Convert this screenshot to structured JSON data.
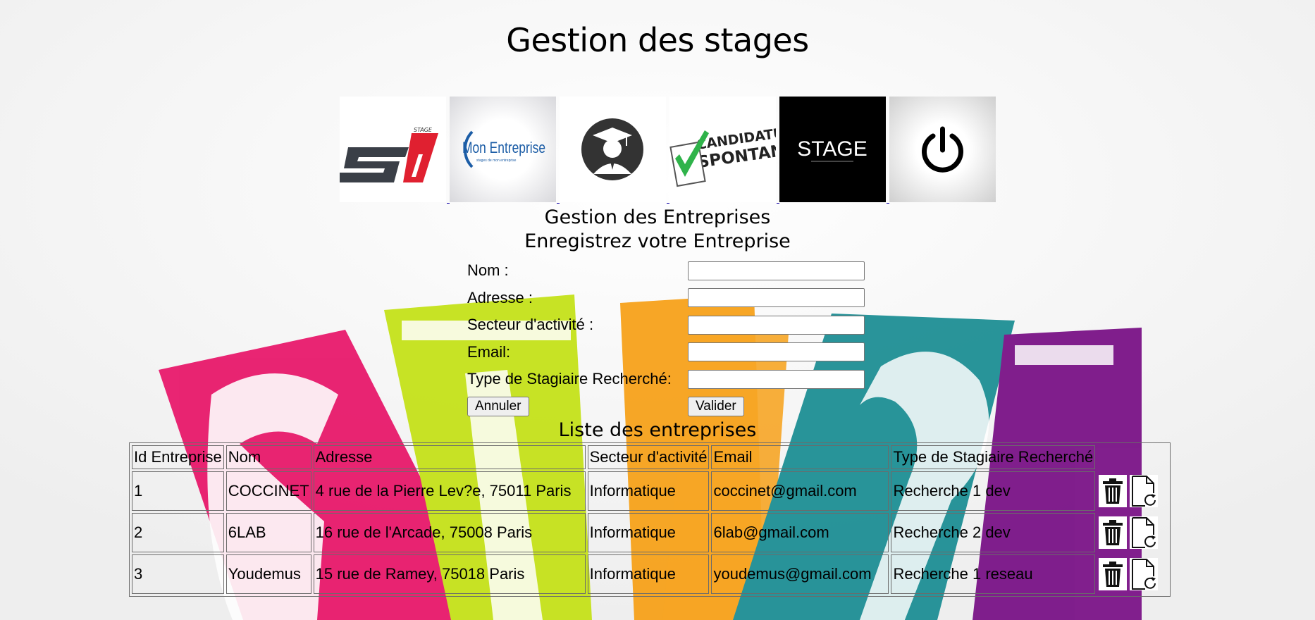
{
  "header": {
    "title": "Gestion des stages"
  },
  "nav": {
    "items": [
      {
        "icon": "stage-s1-logo",
        "logo_text": "STAGE",
        "logo_mark": "S1"
      },
      {
        "icon": "mon-entreprise-logo",
        "logo_text": "Mon Entreprise",
        "logo_sub": "stages de mon entreprise"
      },
      {
        "icon": "graduate-icon"
      },
      {
        "icon": "candidature-spontanee-logo",
        "logo_text_1": "CANDIDATURE",
        "logo_text_2": "SPONTANÉE"
      },
      {
        "icon": "stage-logo",
        "logo_text": "STAGE"
      },
      {
        "icon": "power-icon"
      }
    ]
  },
  "section": {
    "title": "Gestion des Entreprises",
    "subtitle": "Enregistrez votre Entreprise"
  },
  "form": {
    "nom_label": "Nom :",
    "adresse_label": "Adresse :",
    "secteur_label": "Secteur d'activité :",
    "email_label": "Email:",
    "type_label": "Type de Stagiaire Recherché:",
    "nom_value": "",
    "adresse_value": "",
    "secteur_value": "",
    "email_value": "",
    "type_value": "",
    "cancel_label": "Annuler",
    "submit_label": "Valider"
  },
  "list": {
    "title": "Liste des entreprises",
    "columns": [
      "Id Entreprise",
      "Nom",
      "Adresse",
      "Secteur d'activité",
      "Email",
      "Type de Stagiaire Recherché"
    ],
    "rows": [
      [
        "1",
        "COCCINET",
        "4 rue de la Pierre Lev?e, 75011 Paris",
        "Informatique",
        "coccinet@gmail.com",
        "Recherche 1 dev"
      ],
      [
        "2",
        "6LAB",
        "16 rue de l'Arcade, 75008 Paris",
        "Informatique",
        "6lab@gmail.com",
        "Recherche 2 dev"
      ],
      [
        "3",
        "Youdemus",
        "15 rue de Ramey, 75018 Paris",
        "Informatique",
        "youdemus@gmail.com",
        "Recherche 1 reseau"
      ]
    ],
    "row_actions": [
      "trash-icon",
      "edit-document-icon"
    ]
  },
  "colors": {
    "background": "#f7f7f7",
    "pink": "#e8196b",
    "lime": "#c5e21a",
    "orange": "#f7a21b",
    "teal": "#1e8f95",
    "purple": "#7a1387",
    "link": "#1a0dab"
  }
}
